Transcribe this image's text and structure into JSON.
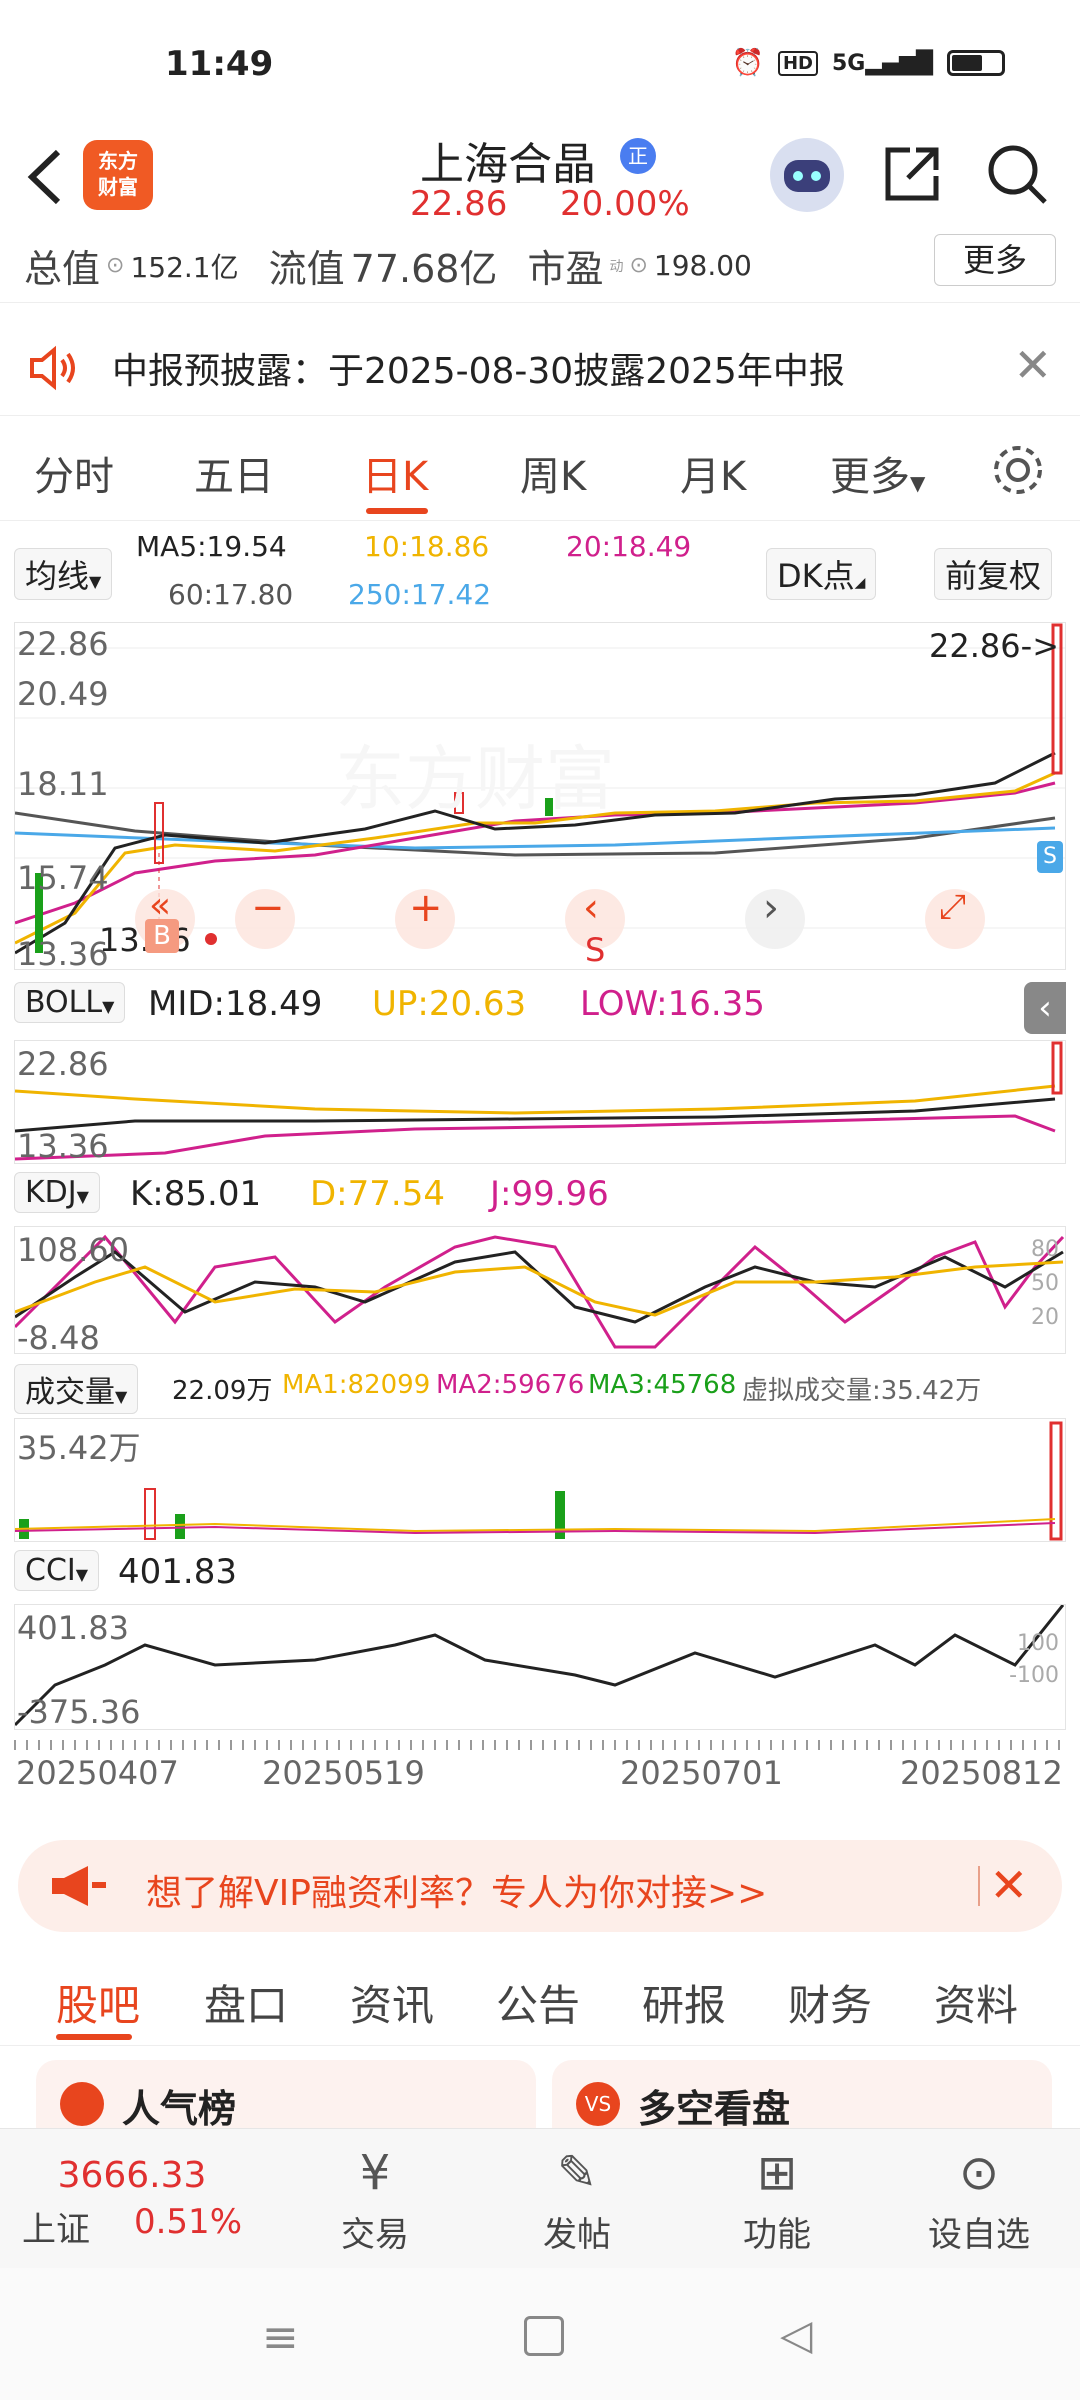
{
  "status_bar": {
    "time": "11:49",
    "icons": [
      "alarm-icon",
      "hd-icon",
      "5g-signal-icon",
      "battery-icon"
    ]
  },
  "header": {
    "stock_name": "上海合晶",
    "stock_tag": "正",
    "price": "22.86",
    "change_pct": "20.00%",
    "logo_line1": "东方",
    "logo_line2": "财富"
  },
  "metrics": {
    "total_value_label": "总值",
    "total_value": "152.1亿",
    "float_value_label": "流值",
    "float_value": "77.68亿",
    "pe_label": "市盈",
    "pe_sup": "动",
    "pe_value": "198.00",
    "more_label": "更多"
  },
  "notice": {
    "text": "中报预披露：于2025-08-30披露2025年中报"
  },
  "kline_tabs": {
    "items": [
      "分时",
      "五日",
      "日K",
      "周K",
      "月K",
      "更多"
    ],
    "active": "日K"
  },
  "ma_row": {
    "selector": "均线",
    "ma5": "MA5:19.54",
    "ma10": "10:18.86",
    "ma20": "20:18.49",
    "ma60": "60:17.80",
    "ma250": "250:17.42",
    "dk_label": "DK点",
    "adjust_label": "前复权"
  },
  "main_chart": {
    "high_label": "22.86",
    "level2_label": "20.49",
    "level3_label": "18.11",
    "level4_label": "15.74",
    "low_label": "13.36",
    "price_pointer": "22.86->",
    "min_marker": "13.56",
    "buy_marker": "B",
    "sell_marker": "S",
    "s_badge": "S",
    "watermark": "东方财富"
  },
  "boll": {
    "selector": "BOLL",
    "mid": "MID:18.49",
    "up": "UP:20.63",
    "low": "LOW:16.35",
    "high_label": "22.86",
    "low_label": "13.36"
  },
  "kdj": {
    "selector": "KDJ",
    "k": "K:85.01",
    "d": "D:77.54",
    "j": "J:99.96",
    "high_label": "108.60",
    "low_label": "-8.48",
    "ref80": "80",
    "ref50": "50",
    "ref20": "20"
  },
  "volume": {
    "selector": "成交量",
    "value": "22.09万",
    "ma1": "MA1:82099",
    "ma2": "MA2:59676",
    "ma3": "MA3:45768",
    "virtual": "虚拟成交量:35.42万",
    "high_label": "35.42万"
  },
  "cci": {
    "selector": "CCI",
    "value": "401.83",
    "high_label": "401.83",
    "low_label": "-375.36",
    "ref_pos": "100",
    "ref_neg": "-100"
  },
  "x_axis": {
    "dates": [
      "20250407",
      "20250519",
      "20250701",
      "20250812"
    ]
  },
  "promo": {
    "text": "想了解VIP融资利率？专人为你对接>>"
  },
  "bottom_tabs": {
    "items": [
      "股吧",
      "盘口",
      "资讯",
      "公告",
      "研报",
      "财务",
      "资料"
    ],
    "active": "股吧"
  },
  "cards": {
    "left": "人气榜",
    "right": "多空看盘"
  },
  "dock": {
    "index_value": "3666.33",
    "index_name": "上证",
    "index_change": "0.51%",
    "trade": "交易",
    "post": "发帖",
    "func": "功能",
    "watchlist": "设自选"
  },
  "colors": {
    "up": "#e03030",
    "accent": "#e8451e",
    "ma5": "#222222",
    "ma10": "#f0b400",
    "ma20": "#d0208c",
    "ma60": "#555555",
    "ma250": "#4aa8e8",
    "down": "#1aa01a"
  }
}
